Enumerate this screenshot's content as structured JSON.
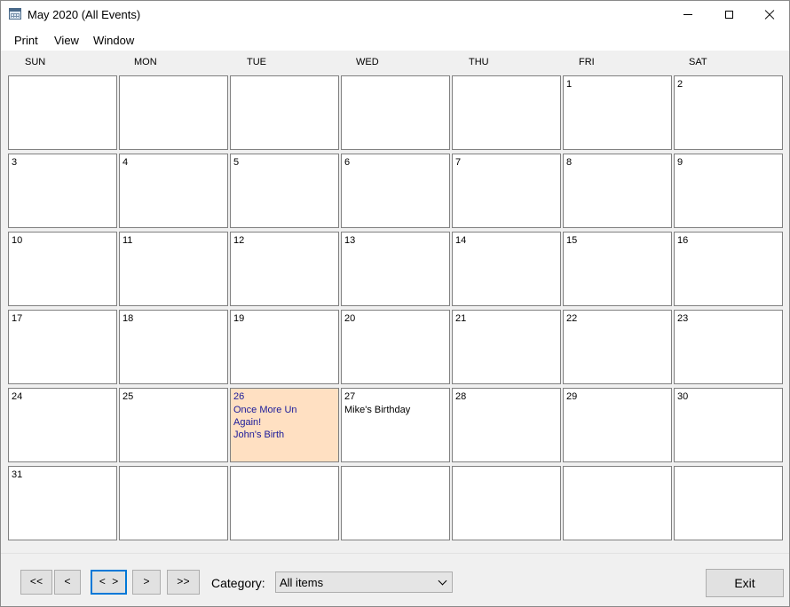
{
  "window": {
    "title": "May 2020 (All Events)",
    "icon": "calendar-icon"
  },
  "menu": [
    "Print",
    "View",
    "Window"
  ],
  "day_headers": [
    "SUN",
    "MON",
    "TUE",
    "WED",
    "THU",
    "FRI",
    "SAT"
  ],
  "weeks": [
    [
      {
        "num": "",
        "events": []
      },
      {
        "num": "",
        "events": []
      },
      {
        "num": "",
        "events": []
      },
      {
        "num": "",
        "events": []
      },
      {
        "num": "",
        "events": []
      },
      {
        "num": "1",
        "events": []
      },
      {
        "num": "2",
        "events": []
      }
    ],
    [
      {
        "num": "3",
        "events": []
      },
      {
        "num": "4",
        "events": []
      },
      {
        "num": "5",
        "events": []
      },
      {
        "num": "6",
        "events": []
      },
      {
        "num": "7",
        "events": []
      },
      {
        "num": "8",
        "events": []
      },
      {
        "num": "9",
        "events": []
      }
    ],
    [
      {
        "num": "10",
        "events": []
      },
      {
        "num": "11",
        "events": []
      },
      {
        "num": "12",
        "events": []
      },
      {
        "num": "13",
        "events": []
      },
      {
        "num": "14",
        "events": []
      },
      {
        "num": "15",
        "events": []
      },
      {
        "num": "16",
        "events": []
      }
    ],
    [
      {
        "num": "17",
        "events": []
      },
      {
        "num": "18",
        "events": []
      },
      {
        "num": "19",
        "events": []
      },
      {
        "num": "20",
        "events": []
      },
      {
        "num": "21",
        "events": []
      },
      {
        "num": "22",
        "events": []
      },
      {
        "num": "23",
        "events": []
      }
    ],
    [
      {
        "num": "24",
        "events": []
      },
      {
        "num": "25",
        "events": []
      },
      {
        "num": "26",
        "highlight": true,
        "events": [
          {
            "text": "Once More Un",
            "color": "blue"
          },
          {
            "text": "Again!",
            "color": "blue"
          },
          {
            "text": "John's Birth",
            "color": "blue"
          }
        ]
      },
      {
        "num": "27",
        "events": [
          {
            "text": "Mike's Birthday",
            "color": "black"
          }
        ]
      },
      {
        "num": "28",
        "events": []
      },
      {
        "num": "29",
        "events": []
      },
      {
        "num": "30",
        "events": []
      }
    ],
    [
      {
        "num": "31",
        "events": []
      },
      {
        "num": "",
        "events": []
      },
      {
        "num": "",
        "events": []
      },
      {
        "num": "",
        "events": []
      },
      {
        "num": "",
        "events": []
      },
      {
        "num": "",
        "events": []
      },
      {
        "num": "",
        "events": []
      }
    ]
  ],
  "nav_buttons": {
    "first": "<<",
    "prev": "<",
    "today": "< >",
    "next": ">",
    "last": ">>"
  },
  "category": {
    "label": "Category:",
    "selected": "All items"
  },
  "exit_label": "Exit",
  "colors": {
    "highlight_bg": "#ffe0c2",
    "event_blue": "#1a1a9a",
    "focus_border": "#0078d7"
  }
}
